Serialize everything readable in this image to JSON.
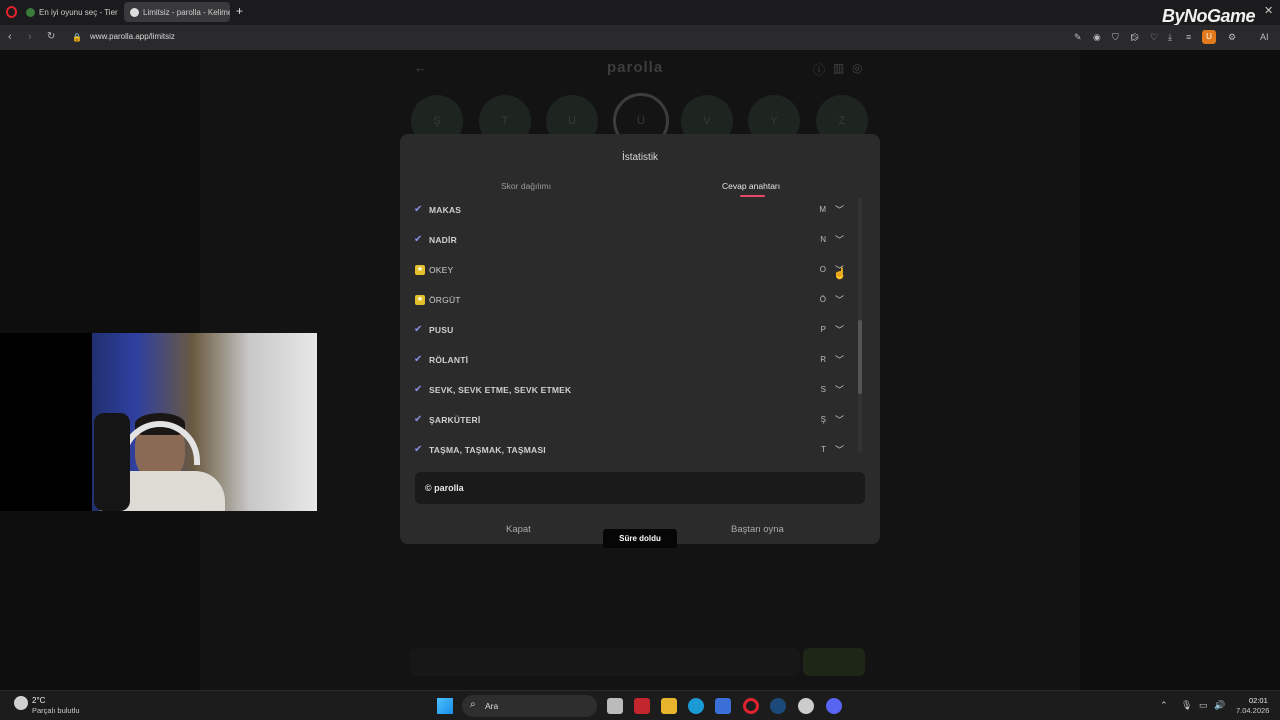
{
  "browser": {
    "tabs": [
      {
        "title": "En iyi oyunu seç - Tier List"
      },
      {
        "title": "Limitsiz - parolla - Kelime"
      }
    ],
    "new_tab": "+",
    "url": "www.parolla.app/limitsiz",
    "ai_label": "AI",
    "ext_badge": "U"
  },
  "brand": "ByNoGame",
  "site": {
    "logo": "parolla",
    "letter_circles": [
      "Ş",
      "T",
      "U",
      "Ü",
      "V",
      "Y",
      "Z"
    ]
  },
  "modal": {
    "title": "İstatistik",
    "tabs": [
      "Skor dağılımı",
      "Cevap anahtarı"
    ],
    "active_tab": 1,
    "answers": [
      {
        "word": "MAKAS",
        "letter": "M",
        "status": "correct"
      },
      {
        "word": "NADİR",
        "letter": "N",
        "status": "correct"
      },
      {
        "word": "OKEY",
        "letter": "O",
        "status": "passed"
      },
      {
        "word": "ÖRGÜT",
        "letter": "Ö",
        "status": "passed"
      },
      {
        "word": "PUSU",
        "letter": "P",
        "status": "correct"
      },
      {
        "word": "RÖLANTİ",
        "letter": "R",
        "status": "correct"
      },
      {
        "word": "SEVK, SEVK ETME, SEVK ETMEK",
        "letter": "S",
        "status": "correct"
      },
      {
        "word": "ŞARKÜTERİ",
        "letter": "Ş",
        "status": "correct"
      },
      {
        "word": "TAŞMA, TAŞMAK, TAŞMASI",
        "letter": "T",
        "status": "correct"
      }
    ],
    "copyright": "© parolla",
    "close_label": "Kapat",
    "restart_label": "Baştan oyna"
  },
  "toast": "Süre doldu",
  "taskbar": {
    "weather_temp": "2°C",
    "weather_desc": "Parçalı bulutlu",
    "search_label": "Ara",
    "time": "02:01",
    "date": "7.04.2026"
  },
  "colors": {
    "accent_underline": "#e8486b",
    "check": "#8a8fe0",
    "star": "#e3c02b"
  }
}
